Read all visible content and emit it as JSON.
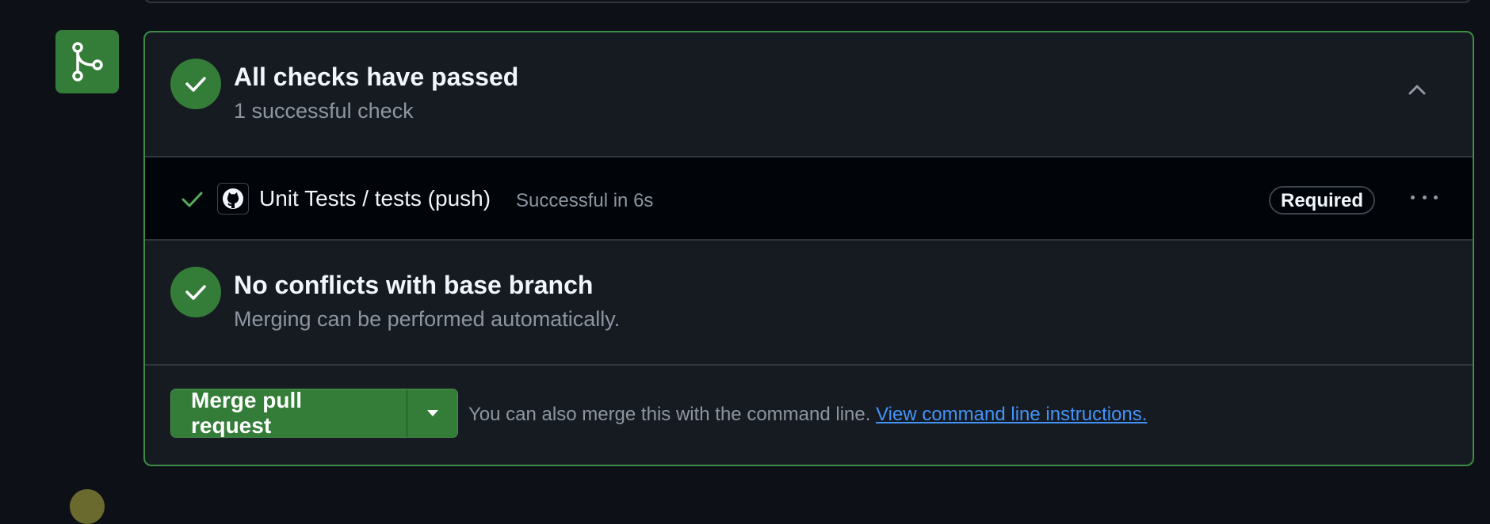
{
  "checks": {
    "title": "All checks have passed",
    "subtitle": "1 successful check"
  },
  "check_run": {
    "name": "Unit Tests / tests (push)",
    "status": "Successful in 6s",
    "badge": "Required"
  },
  "conflicts": {
    "title": "No conflicts with base branch",
    "subtitle": "Merging can be performed automatically."
  },
  "merge": {
    "button_label": "Merge pull request",
    "note": "You can also merge this with the command line.",
    "link_text": "View command line instructions."
  },
  "colors": {
    "background": "#0d1117",
    "panel": "#161b22",
    "success": "#347d39",
    "link": "#4493f8"
  },
  "icons": [
    "git-merge-icon",
    "check-icon",
    "chevron-up-icon",
    "github-logo-icon",
    "kebab-horizontal-icon",
    "triangle-down-icon"
  ]
}
